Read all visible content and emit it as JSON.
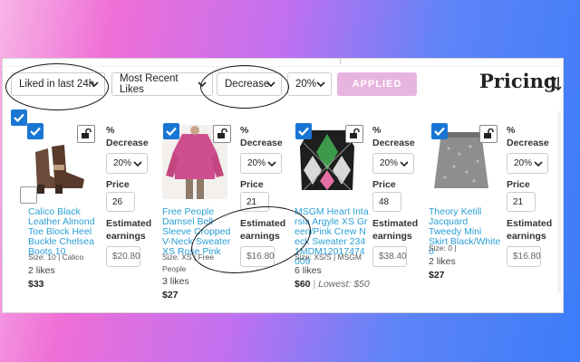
{
  "toolbar": {
    "liked_filter": "Liked in last 24h",
    "sort_by": "Most Recent Likes",
    "direction": "Decrease",
    "percent": "20%",
    "applied_label": "APPLIED",
    "brand": "Pricing",
    "accent_color": "#e7b4df"
  },
  "labels": {
    "pct": "%",
    "decrease": "Decrease",
    "price": "Price",
    "estimated": "Estimated",
    "earnings": "earnings"
  },
  "items": [
    {
      "title": "Calico Black Leather Almond Toe Block Heel Buckle Chelsea Boots 10",
      "meta": "Size: 10 | Calico",
      "likes": "2 likes",
      "price": "$33",
      "pct": "20%",
      "new_price": "26",
      "earnings": "$20.80"
    },
    {
      "title": "Free People Damsel Bell Sleeve Cropped V-Neck Sweater XS Rose Pink",
      "meta": "Size: XS | Free",
      "meta2": "People",
      "likes": "3 likes",
      "price": "$27",
      "pct": "20%",
      "new_price": "21",
      "earnings": "$16.80"
    },
    {
      "title": "MSGM Heart Intarsia Argyle XS Green/Pink Crew Neck Sweater 2341MDM12017474009",
      "meta": "Size: XS/S | MSGM",
      "likes": "6 likes",
      "price": "$60",
      "lowest": "Lowest: $50",
      "pct": "20%",
      "new_price": "48",
      "earnings": "$38.40"
    },
    {
      "title": "Theory Ketill Jacquard Tweedy Mini Skirt Black/White 0",
      "meta": "Size: 0 |",
      "likes": "2 likes",
      "price": "$27",
      "pct": "20%",
      "new_price": "21",
      "earnings": "$16.80"
    }
  ]
}
